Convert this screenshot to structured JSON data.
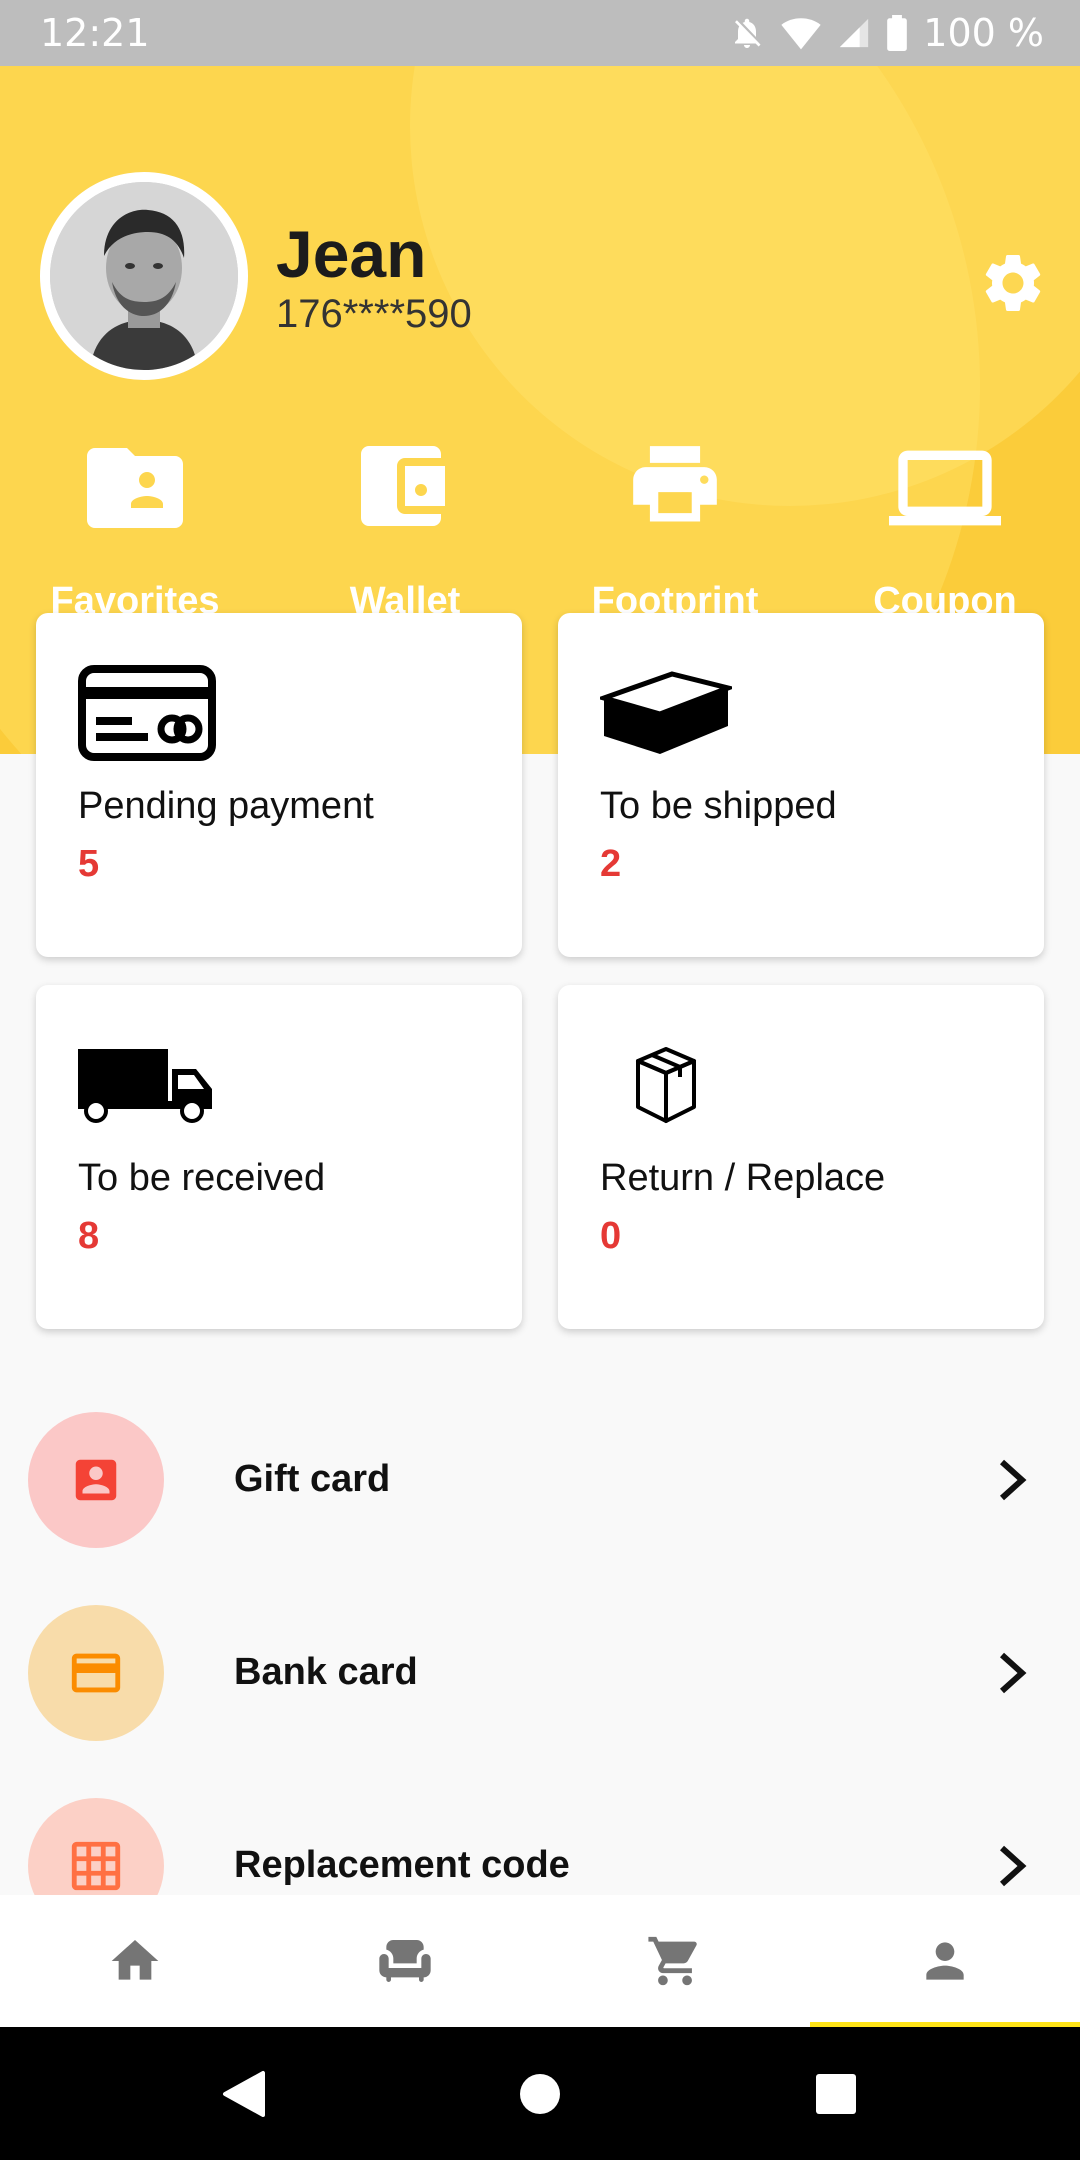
{
  "status_bar": {
    "time": "12:21",
    "battery": "100 %"
  },
  "profile": {
    "name": "Jean",
    "phone": "176****590"
  },
  "quick_actions": [
    {
      "label": "Favorites",
      "icon": "folder-account-icon"
    },
    {
      "label": "Wallet",
      "icon": "wallet-icon"
    },
    {
      "label": "Footprint",
      "icon": "printer-icon"
    },
    {
      "label": "Coupon",
      "icon": "laptop-icon"
    }
  ],
  "orders": [
    {
      "label": "Pending payment",
      "count": "5",
      "icon": "credit-card-icon"
    },
    {
      "label": "To be shipped",
      "count": "2",
      "icon": "box-icon"
    },
    {
      "label": "To be received",
      "count": "8",
      "icon": "truck-icon"
    },
    {
      "label": "Return / Replace",
      "count": "0",
      "icon": "package-icon"
    }
  ],
  "menu": [
    {
      "label": "Gift card",
      "icon": "contact-card-icon",
      "color": "#f44336"
    },
    {
      "label": "Bank card",
      "icon": "bank-card-icon",
      "color": "#fb8c00"
    },
    {
      "label": "Replacement code",
      "icon": "grid-icon",
      "color": "#ff7043"
    }
  ],
  "colors": {
    "header": "#fbcc3a",
    "accent_count": "#e53935",
    "nav_active": "#ffe418"
  },
  "bottom_nav": [
    {
      "icon": "home-icon"
    },
    {
      "icon": "chair-icon"
    },
    {
      "icon": "cart-icon"
    },
    {
      "icon": "person-icon",
      "active": true
    }
  ]
}
